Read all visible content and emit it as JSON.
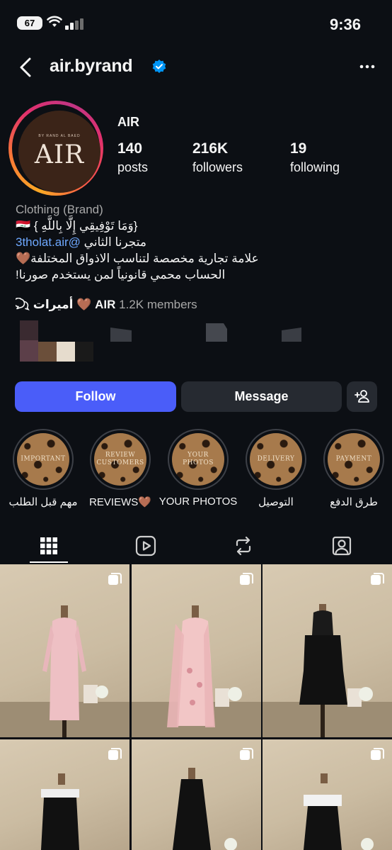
{
  "status_bar": {
    "time": "9:36",
    "battery": "67"
  },
  "header": {
    "username": "air.byrand"
  },
  "profile": {
    "avatar_small_text": "BY RAND AL BAED",
    "avatar_logo": "AIR",
    "display_name": "AIR",
    "stats": [
      {
        "value": "140",
        "label": "posts"
      },
      {
        "value": "216K",
        "label": "followers"
      },
      {
        "value": "19",
        "label": "following"
      }
    ]
  },
  "bio": {
    "category": "Clothing (Brand)",
    "line1": "🇮🇶 { وَمَا تَوْفِيقِي إِلَّا بِاللَّهِ}",
    "line2_prefix": "متجرنا الثاني",
    "line2_link": "3tholat.air@",
    "line3": "علامة تجارية مخصصة لتناسب الاذواق المختلفة🤎",
    "line4": "الحساب محمي قانونياً لمن يستخدم صورنا!"
  },
  "community": {
    "name": "أميرات 🤎 AIR",
    "members": "1.2K members"
  },
  "buttons": {
    "follow": "Follow",
    "message": "Message"
  },
  "highlights": [
    {
      "cover_text": "IMPORTANT",
      "label": "مهم قبل الطلب"
    },
    {
      "cover_text": "REVIEW CUSTOMERS",
      "label": "REVIEWS🤎"
    },
    {
      "cover_text": "YOUR PHOTOS",
      "label": "YOUR PHOTOS"
    },
    {
      "cover_text": "DELIVERY",
      "label": "التوصيل"
    },
    {
      "cover_text": "PAYMENT",
      "label": "طرق الدفع"
    }
  ],
  "tabs": [
    "grid-icon",
    "reels-icon",
    "reposts-icon",
    "tagged-icon"
  ],
  "colors": {
    "accent": "#4a5df9",
    "verified": "#0095f6",
    "link": "#6ea8ff"
  }
}
